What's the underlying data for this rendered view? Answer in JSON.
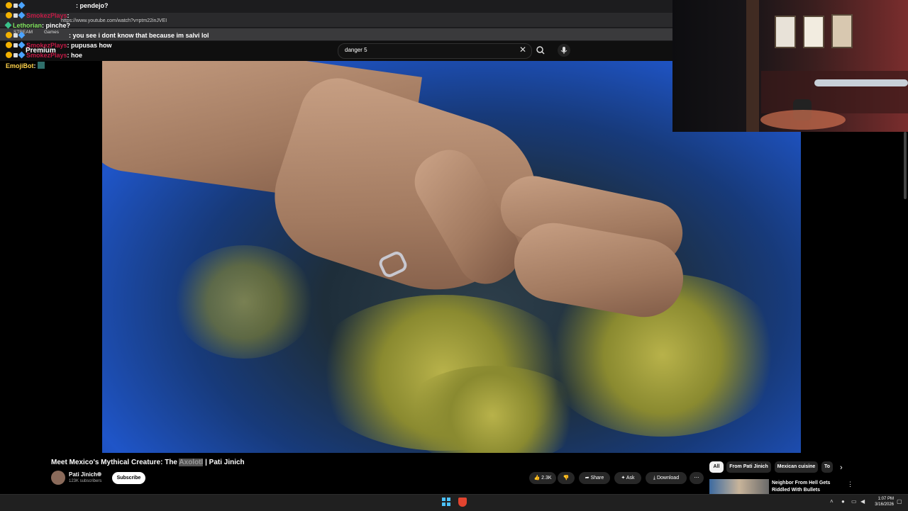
{
  "browser": {
    "url": "https://www.youtube.com/watch?v=ptm22inJVEI",
    "bookmarks": [
      "STREAM",
      "Games"
    ]
  },
  "youtube": {
    "premium_label": "Premium",
    "search_value": "danger 5"
  },
  "chat": [
    {
      "user": "",
      "message": "pendejo?"
    },
    {
      "user": "SmokezPlays",
      "message": ""
    },
    {
      "user": "Lethorian",
      "message": "pinche?"
    },
    {
      "user": "",
      "message": "you see i dont know that because im salvi lol"
    },
    {
      "user": "SmokezPlays",
      "message": "pupusas how"
    },
    {
      "user": "SmokezPlays",
      "message": "hoe"
    },
    {
      "user": "EmojiBot",
      "message": ""
    }
  ],
  "video": {
    "title_prefix": "Meet Mexico's Mythical Creature: The",
    "title_highlight": "Axolotl",
    "title_suffix": "| Pati Jinich",
    "channel": "Pati Jinich",
    "subscribers": "123K subscribers",
    "subscribe_label": "Subscribe",
    "likes": "2.3K",
    "share_label": "Share",
    "ask_label": "Ask",
    "download_label": "Download"
  },
  "chips": [
    "All",
    "From Pati Jinich",
    "Mexican cuisine",
    "To"
  ],
  "recommendation": {
    "title": "Neighbor From Hell Gets Riddled With Bullets"
  },
  "taskbar": {
    "time": "1:07 PM",
    "date": "3/16/2026"
  },
  "colors": {
    "accent_red": "#c21a45",
    "youtube_bg": "#0f0f0f"
  }
}
